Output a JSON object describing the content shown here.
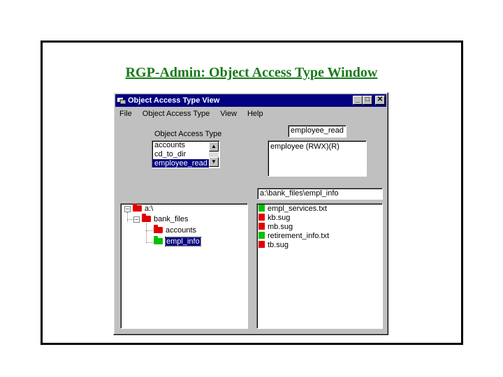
{
  "slide": {
    "title": "RGP-Admin: Object Access Type Window"
  },
  "window": {
    "title": "Object Access Type View",
    "controls": {
      "minimize": "_",
      "maximize": "□",
      "close": "✕"
    }
  },
  "menu": [
    "File",
    "Object Access Type",
    "View",
    "Help"
  ],
  "access_type": {
    "label": "Object Access Type",
    "items": [
      {
        "label": "accounts",
        "selected": false
      },
      {
        "label": "cd_to_dir",
        "selected": false
      },
      {
        "label": "employee_read",
        "selected": true
      }
    ],
    "name_field": "employee_read",
    "rights": "employee  (RWX)(R)"
  },
  "path_field": "a:\\bank_files\\empl_info",
  "tree": {
    "root": "a:\\",
    "folder": "bank_files",
    "children": [
      "accounts",
      "empl_info"
    ],
    "selected": "empl_info"
  },
  "files": [
    {
      "name": "empl_services.txt",
      "color": "green"
    },
    {
      "name": "kb.sug",
      "color": "red"
    },
    {
      "name": "mb.sug",
      "color": "red"
    },
    {
      "name": "retirement_info.txt",
      "color": "green"
    },
    {
      "name": "tb.sug",
      "color": "red"
    }
  ],
  "colors": {
    "title_green": "#1a7a1a",
    "titlebar_blue": "#000080",
    "folder_red": "#e00000",
    "folder_green": "#00c000"
  }
}
